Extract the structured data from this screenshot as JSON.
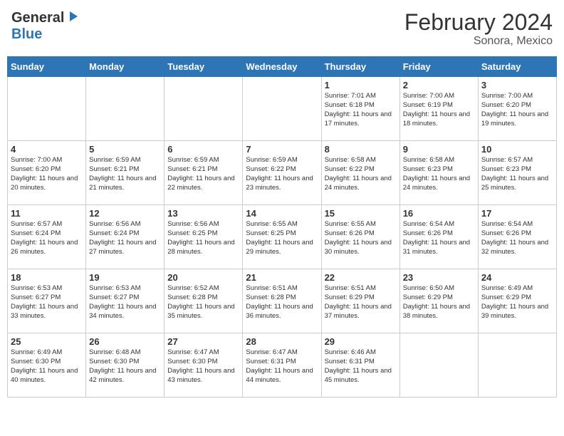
{
  "header": {
    "logo_general": "General",
    "logo_blue": "Blue",
    "month_title": "February 2024",
    "location": "Sonora, Mexico"
  },
  "weekdays": [
    "Sunday",
    "Monday",
    "Tuesday",
    "Wednesday",
    "Thursday",
    "Friday",
    "Saturday"
  ],
  "weeks": [
    [
      {
        "day": "",
        "info": ""
      },
      {
        "day": "",
        "info": ""
      },
      {
        "day": "",
        "info": ""
      },
      {
        "day": "",
        "info": ""
      },
      {
        "day": "1",
        "info": "Sunrise: 7:01 AM\nSunset: 6:18 PM\nDaylight: 11 hours and 17 minutes."
      },
      {
        "day": "2",
        "info": "Sunrise: 7:00 AM\nSunset: 6:19 PM\nDaylight: 11 hours and 18 minutes."
      },
      {
        "day": "3",
        "info": "Sunrise: 7:00 AM\nSunset: 6:20 PM\nDaylight: 11 hours and 19 minutes."
      }
    ],
    [
      {
        "day": "4",
        "info": "Sunrise: 7:00 AM\nSunset: 6:20 PM\nDaylight: 11 hours and 20 minutes."
      },
      {
        "day": "5",
        "info": "Sunrise: 6:59 AM\nSunset: 6:21 PM\nDaylight: 11 hours and 21 minutes."
      },
      {
        "day": "6",
        "info": "Sunrise: 6:59 AM\nSunset: 6:21 PM\nDaylight: 11 hours and 22 minutes."
      },
      {
        "day": "7",
        "info": "Sunrise: 6:59 AM\nSunset: 6:22 PM\nDaylight: 11 hours and 23 minutes."
      },
      {
        "day": "8",
        "info": "Sunrise: 6:58 AM\nSunset: 6:22 PM\nDaylight: 11 hours and 24 minutes."
      },
      {
        "day": "9",
        "info": "Sunrise: 6:58 AM\nSunset: 6:23 PM\nDaylight: 11 hours and 24 minutes."
      },
      {
        "day": "10",
        "info": "Sunrise: 6:57 AM\nSunset: 6:23 PM\nDaylight: 11 hours and 25 minutes."
      }
    ],
    [
      {
        "day": "11",
        "info": "Sunrise: 6:57 AM\nSunset: 6:24 PM\nDaylight: 11 hours and 26 minutes."
      },
      {
        "day": "12",
        "info": "Sunrise: 6:56 AM\nSunset: 6:24 PM\nDaylight: 11 hours and 27 minutes."
      },
      {
        "day": "13",
        "info": "Sunrise: 6:56 AM\nSunset: 6:25 PM\nDaylight: 11 hours and 28 minutes."
      },
      {
        "day": "14",
        "info": "Sunrise: 6:55 AM\nSunset: 6:25 PM\nDaylight: 11 hours and 29 minutes."
      },
      {
        "day": "15",
        "info": "Sunrise: 6:55 AM\nSunset: 6:26 PM\nDaylight: 11 hours and 30 minutes."
      },
      {
        "day": "16",
        "info": "Sunrise: 6:54 AM\nSunset: 6:26 PM\nDaylight: 11 hours and 31 minutes."
      },
      {
        "day": "17",
        "info": "Sunrise: 6:54 AM\nSunset: 6:26 PM\nDaylight: 11 hours and 32 minutes."
      }
    ],
    [
      {
        "day": "18",
        "info": "Sunrise: 6:53 AM\nSunset: 6:27 PM\nDaylight: 11 hours and 33 minutes."
      },
      {
        "day": "19",
        "info": "Sunrise: 6:53 AM\nSunset: 6:27 PM\nDaylight: 11 hours and 34 minutes."
      },
      {
        "day": "20",
        "info": "Sunrise: 6:52 AM\nSunset: 6:28 PM\nDaylight: 11 hours and 35 minutes."
      },
      {
        "day": "21",
        "info": "Sunrise: 6:51 AM\nSunset: 6:28 PM\nDaylight: 11 hours and 36 minutes."
      },
      {
        "day": "22",
        "info": "Sunrise: 6:51 AM\nSunset: 6:29 PM\nDaylight: 11 hours and 37 minutes."
      },
      {
        "day": "23",
        "info": "Sunrise: 6:50 AM\nSunset: 6:29 PM\nDaylight: 11 hours and 38 minutes."
      },
      {
        "day": "24",
        "info": "Sunrise: 6:49 AM\nSunset: 6:29 PM\nDaylight: 11 hours and 39 minutes."
      }
    ],
    [
      {
        "day": "25",
        "info": "Sunrise: 6:49 AM\nSunset: 6:30 PM\nDaylight: 11 hours and 40 minutes."
      },
      {
        "day": "26",
        "info": "Sunrise: 6:48 AM\nSunset: 6:30 PM\nDaylight: 11 hours and 42 minutes."
      },
      {
        "day": "27",
        "info": "Sunrise: 6:47 AM\nSunset: 6:30 PM\nDaylight: 11 hours and 43 minutes."
      },
      {
        "day": "28",
        "info": "Sunrise: 6:47 AM\nSunset: 6:31 PM\nDaylight: 11 hours and 44 minutes."
      },
      {
        "day": "29",
        "info": "Sunrise: 6:46 AM\nSunset: 6:31 PM\nDaylight: 11 hours and 45 minutes."
      },
      {
        "day": "",
        "info": ""
      },
      {
        "day": "",
        "info": ""
      }
    ]
  ]
}
